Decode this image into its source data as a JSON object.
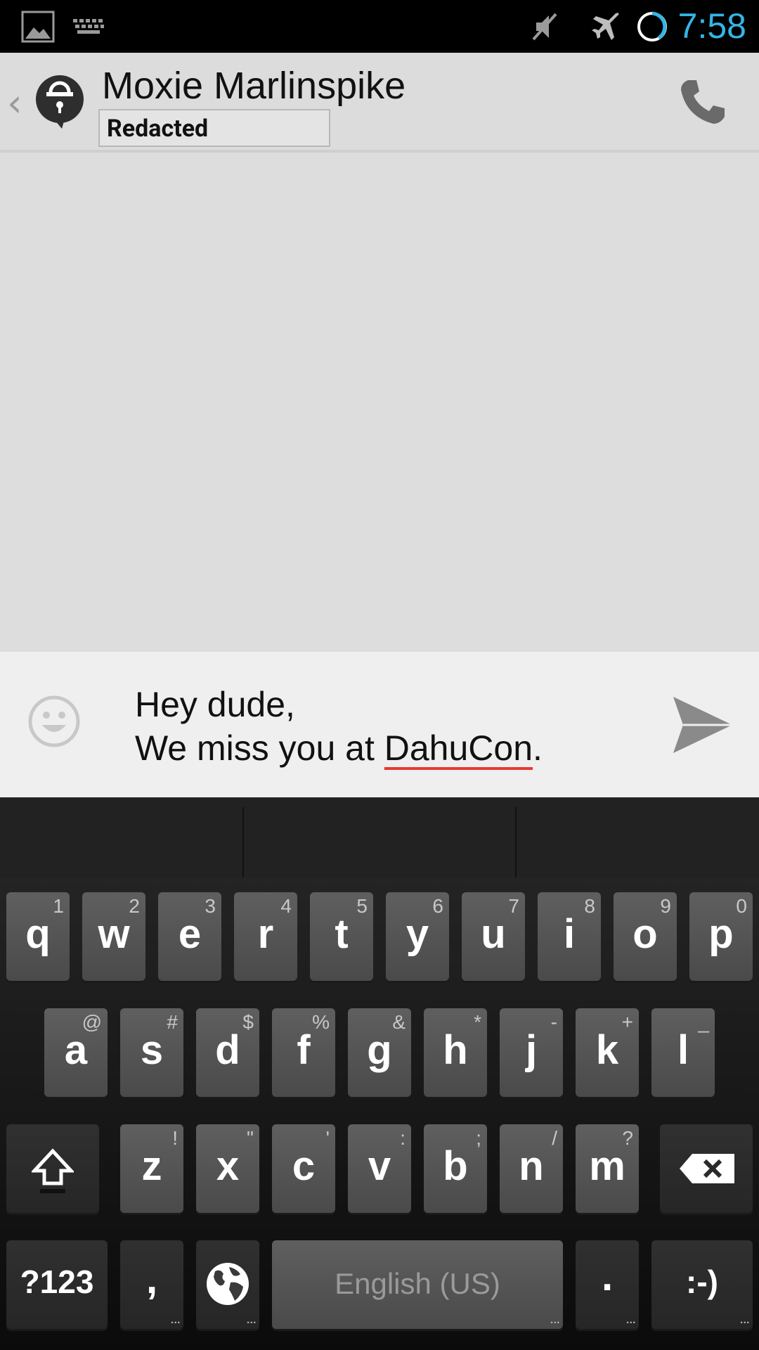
{
  "status_bar": {
    "time": "7:58",
    "icons": [
      "image-notification-icon",
      "keyboard-notification-icon",
      "mute-icon",
      "airplane-mode-icon",
      "battery-icon"
    ]
  },
  "header": {
    "contact_name": "Moxie Marlinspike",
    "subtitle": "Redacted",
    "accent_color": "#33b5e5"
  },
  "compose": {
    "line1": "Hey dude,",
    "line2_prefix": "We miss you at ",
    "line2_misspelled": "DahuCon",
    "line2_suffix": "."
  },
  "keyboard": {
    "row1": [
      {
        "key": "q",
        "hint": "1"
      },
      {
        "key": "w",
        "hint": "2"
      },
      {
        "key": "e",
        "hint": "3"
      },
      {
        "key": "r",
        "hint": "4"
      },
      {
        "key": "t",
        "hint": "5"
      },
      {
        "key": "y",
        "hint": "6"
      },
      {
        "key": "u",
        "hint": "7"
      },
      {
        "key": "i",
        "hint": "8"
      },
      {
        "key": "o",
        "hint": "9"
      },
      {
        "key": "p",
        "hint": "0"
      }
    ],
    "row2": [
      {
        "key": "a",
        "hint": "@"
      },
      {
        "key": "s",
        "hint": "#"
      },
      {
        "key": "d",
        "hint": "$"
      },
      {
        "key": "f",
        "hint": "%"
      },
      {
        "key": "g",
        "hint": "&"
      },
      {
        "key": "h",
        "hint": "*"
      },
      {
        "key": "j",
        "hint": "-"
      },
      {
        "key": "k",
        "hint": "+"
      },
      {
        "key": "l",
        "hint": "_"
      }
    ],
    "row3": [
      {
        "key": "z",
        "hint": "!"
      },
      {
        "key": "x",
        "hint": "\""
      },
      {
        "key": "c",
        "hint": "'"
      },
      {
        "key": "v",
        "hint": ":"
      },
      {
        "key": "b",
        "hint": ";"
      },
      {
        "key": "n",
        "hint": "/"
      },
      {
        "key": "m",
        "hint": "?"
      }
    ],
    "symbols_label": "?123",
    "comma": ",",
    "space_label": "English (US)",
    "period": ".",
    "smiley": ":-)"
  }
}
